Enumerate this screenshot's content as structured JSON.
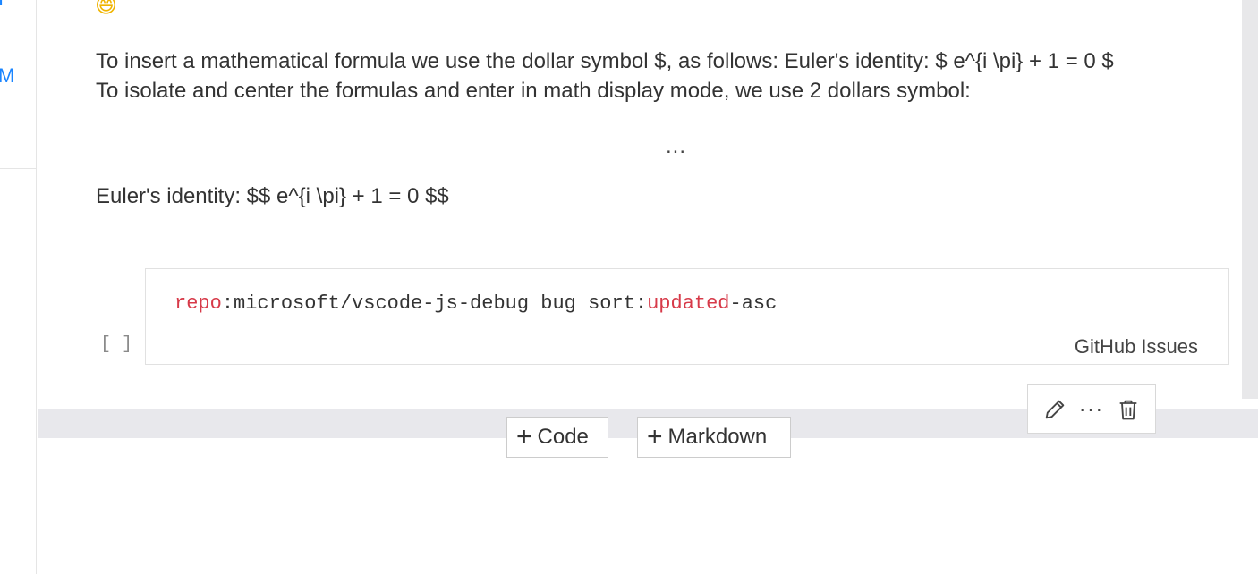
{
  "left_gutter": {
    "chars": [
      "I",
      "M"
    ]
  },
  "markdown": {
    "emoji": "😄",
    "line1": "To insert a mathematical formula we use the dollar symbol $, as follows: Euler's identity: $ e^{i \\pi} + 1 = 0 $",
    "line2": "To isolate and center the formulas and enter in math display mode, we use 2 dollars symbol:",
    "ellipsis": "...",
    "line3": "Euler's identity: $$ e^{i \\pi} + 1 = 0 $$"
  },
  "code_cell": {
    "run_indicator": "[ ]",
    "tokens": {
      "kw1": "repo",
      "plain1": ":microsoft/vscode-js-debug bug sort:",
      "kw2": "updated",
      "plain2": "-asc"
    },
    "language_label": "GitHub Issues"
  },
  "insert_bar": {
    "code_label": "Code",
    "markdown_label": "Markdown",
    "plus": "+"
  },
  "cell_toolbar": {
    "edit_icon": "pencil-icon",
    "more_icon": "more-icon",
    "more_text": "···",
    "delete_icon": "trash-icon"
  },
  "colors": {
    "keyword": "#d73a49",
    "accent": "#1a85ff",
    "band": "#e8e8ec"
  }
}
